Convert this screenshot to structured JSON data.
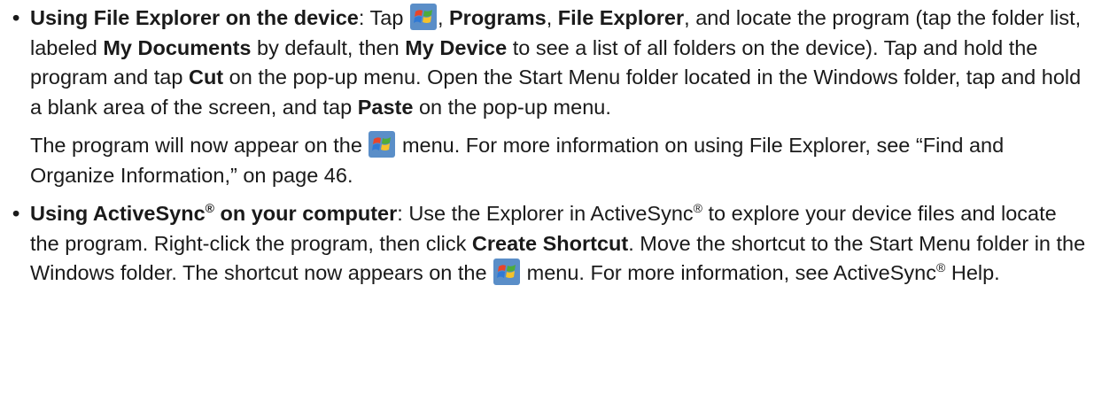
{
  "icon": "windows-start-icon",
  "bullet": "•",
  "item1": {
    "title": "Using File Explorer on the device",
    "t1": ": Tap ",
    "t2": ", ",
    "programs": "Programs",
    "t3": ", ",
    "file_explorer": "File Explorer",
    "t4": ", and locate the program (tap the folder list, labeled ",
    "my_documents": "My Documents",
    "t5": " by default, then ",
    "my_device": "My Device",
    "t6": " to see a list of all folders on the device). Tap and hold the program and tap ",
    "cut": "Cut",
    "t7": " on the pop-up menu. Open the Start Menu folder located in the Windows folder, tap and hold a blank area of the screen, and tap ",
    "paste": "Paste",
    "t8": " on the pop-up menu.",
    "p2_t1": "The program will now appear on the ",
    "p2_t2": " menu. For more information on using File Explorer, see “Find and Organize Information,” on page 46."
  },
  "item2": {
    "title_a": "Using ActiveSync",
    "reg": "®",
    "title_b": " on your computer",
    "t1": ": Use the Explorer in ActiveSync",
    "t2": " to explore your device files and locate the program. Right-click the program, then click ",
    "create_shortcut": "Create Shortcut",
    "t3": ". Move the shortcut to the Start Menu folder in the Windows folder. The shortcut now appears on the ",
    "t4": " menu. For more information, see ActiveSync",
    "t5": " Help."
  }
}
